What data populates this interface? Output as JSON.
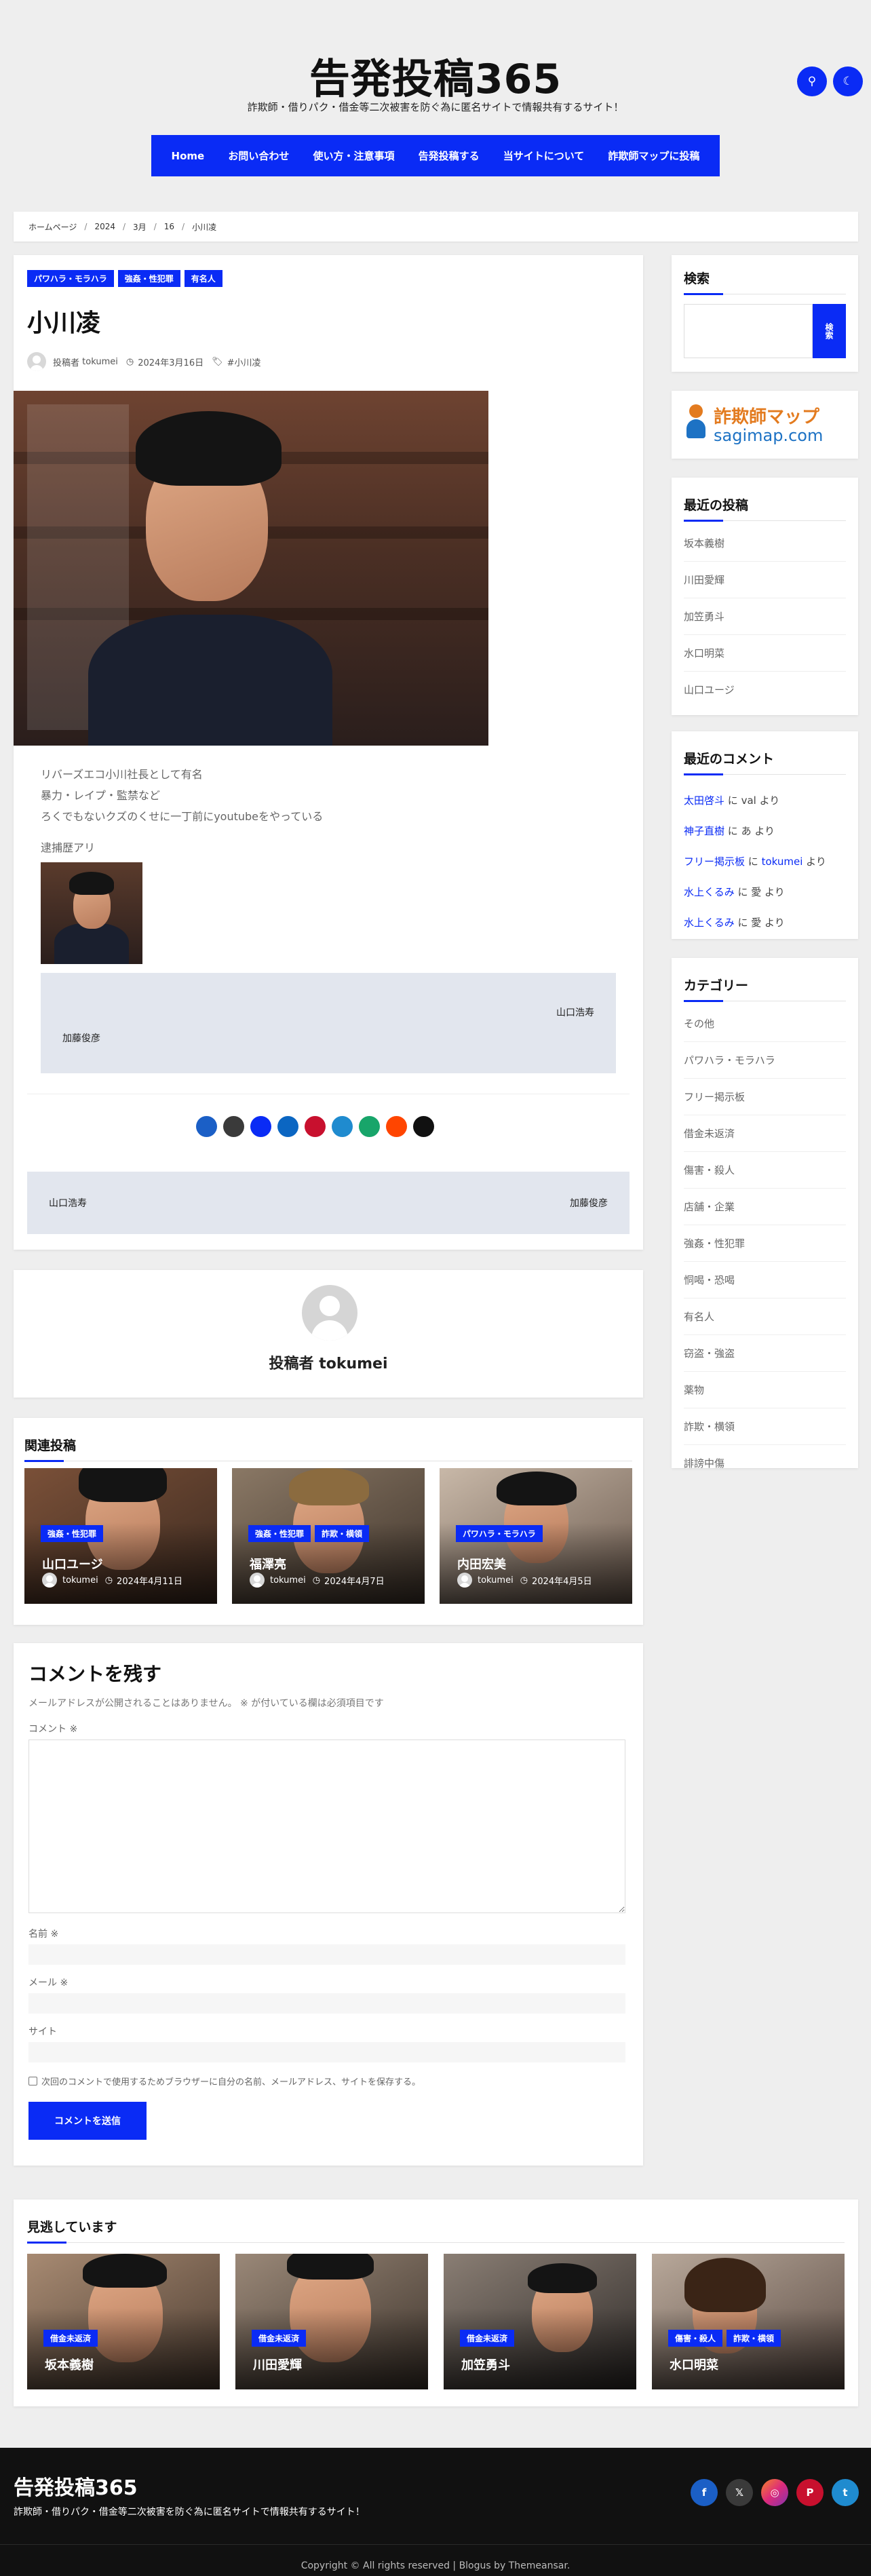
{
  "site": {
    "title": "告発投稿365",
    "description": "詐欺師・借りパク・借金等二次被害を防ぐ為に匿名サイトで情報共有するサイト！"
  },
  "header_buttons": {
    "search_icon": "search-icon",
    "dark_icon": "moon-icon",
    "search_glyph": "⚲",
    "dark_glyph": "☾"
  },
  "nav": [
    "Home",
    "お問い合わせ",
    "使い方・注意事項",
    "告発投稿する",
    "当サイトについて",
    "詐欺師マップに投稿"
  ],
  "breadcrumb": [
    "ホームページ",
    "2024",
    "3月",
    "16",
    "小川凌"
  ],
  "post": {
    "tags": [
      "パワハラ・モラハラ",
      "強姦・性犯罪",
      "有名人"
    ],
    "title": "小川凌",
    "author_prefix": "投稿者",
    "author": "tokumei",
    "date": "2024年3月16日",
    "post_tag": "#小川凌",
    "body": [
      "リバーズエコ小川社長として有名",
      "暴力・レイプ・監禁など",
      "ろくでもないクズのくせに一丁前にyoutubeをやっている"
    ],
    "body2": "逮捕歴アリ",
    "prev_in": "加藤俊彦",
    "next_in": "山口浩寿",
    "prev_in_arrow": "",
    "next_in_arrow": "",
    "prev_post": " 山口浩寿",
    "next_post": "加藤俊彦 ",
    "social_glyphs": [
      "",
      "",
      "",
      "",
      "",
      "",
      "",
      "",
      ""
    ]
  },
  "author_box": {
    "label": "投稿者",
    "name": "tokumei"
  },
  "related": {
    "heading": "関連投稿",
    "items": [
      {
        "tags": [
          "強姦・性犯罪"
        ],
        "title": "山口ユージ",
        "author": "tokumei",
        "date": "2024年4月11日"
      },
      {
        "tags": [
          "強姦・性犯罪",
          "詐欺・横領"
        ],
        "title": "福澤亮",
        "author": "tokumei",
        "date": "2024年4月7日"
      },
      {
        "tags": [
          "パワハラ・モラハラ"
        ],
        "title": "内田宏美",
        "author": "tokumei",
        "date": "2024年4月5日"
      }
    ]
  },
  "comment_form": {
    "heading": "コメントを残す",
    "note": "メールアドレスが公開されることはありません。 ※ が付いている欄は必須項目です",
    "comment_label": "コメント ※",
    "name_label": "名前 ※",
    "email_label": "メール ※",
    "site_label": "サイト",
    "save_label": "次回のコメントで使用するためブラウザーに自分の名前、メールアドレス、サイトを保存する。",
    "submit": "コメントを送信"
  },
  "missed": {
    "heading": "見逃しています",
    "items": [
      {
        "tags": [
          "借金未返済"
        ],
        "title": "坂本義樹"
      },
      {
        "tags": [
          "借金未返済"
        ],
        "title": "川田愛輝"
      },
      {
        "tags": [
          "借金未返済"
        ],
        "title": "加笠勇斗"
      },
      {
        "tags": [
          "傷害・殺人",
          "詐欺・横領"
        ],
        "title": "水口明菜"
      }
    ]
  },
  "sidebar": {
    "search": {
      "heading": "検索",
      "button": "検索"
    },
    "banner": {
      "title": "詐欺師マップ",
      "url": "sagimap.com"
    },
    "recent_posts": {
      "heading": "最近の投稿",
      "items": [
        "坂本義樹",
        "川田愛輝",
        "加笠勇斗",
        "水口明菜",
        "山口ユージ"
      ]
    },
    "recent_comments": {
      "heading": "最近のコメント",
      "items": [
        {
          "post": "太田啓斗",
          "mid": " に ",
          "user": "val",
          "tail": " より"
        },
        {
          "post": "神子直樹",
          "mid": " に ",
          "user": "あ",
          "tail": " より"
        },
        {
          "post": "フリー掲示板",
          "mid": " に ",
          "user": "tokumei",
          "tail": " より"
        },
        {
          "post": "水上くるみ",
          "mid": " に ",
          "user": "愛",
          "tail": " より"
        },
        {
          "post": "水上くるみ",
          "mid": " に ",
          "user": "愛",
          "tail": " より"
        }
      ]
    },
    "categories": {
      "heading": "カテゴリー",
      "items": [
        "その他",
        "パワハラ・モラハラ",
        "フリー掲示板",
        "借金未返済",
        "傷害・殺人",
        "店舗・企業",
        "強姦・性犯罪",
        "恫喝・恐喝",
        "有名人",
        "窃盗・強盗",
        "薬物",
        "詐欺・横領",
        "誹謗中傷"
      ]
    }
  },
  "footer": {
    "title": "告発投稿365",
    "description": "詐欺師・借りパク・借金等二次被害を防ぐ為に匿名サイトで情報共有するサイト！",
    "copyright": "Copyright © All rights reserved | Blogus by Themeansar.",
    "social_glyphs": [
      "f",
      "𝕏",
      "◎",
      "P",
      "t"
    ]
  },
  "colors": {
    "accent": "#0a2bf5",
    "footer": "#111111"
  }
}
